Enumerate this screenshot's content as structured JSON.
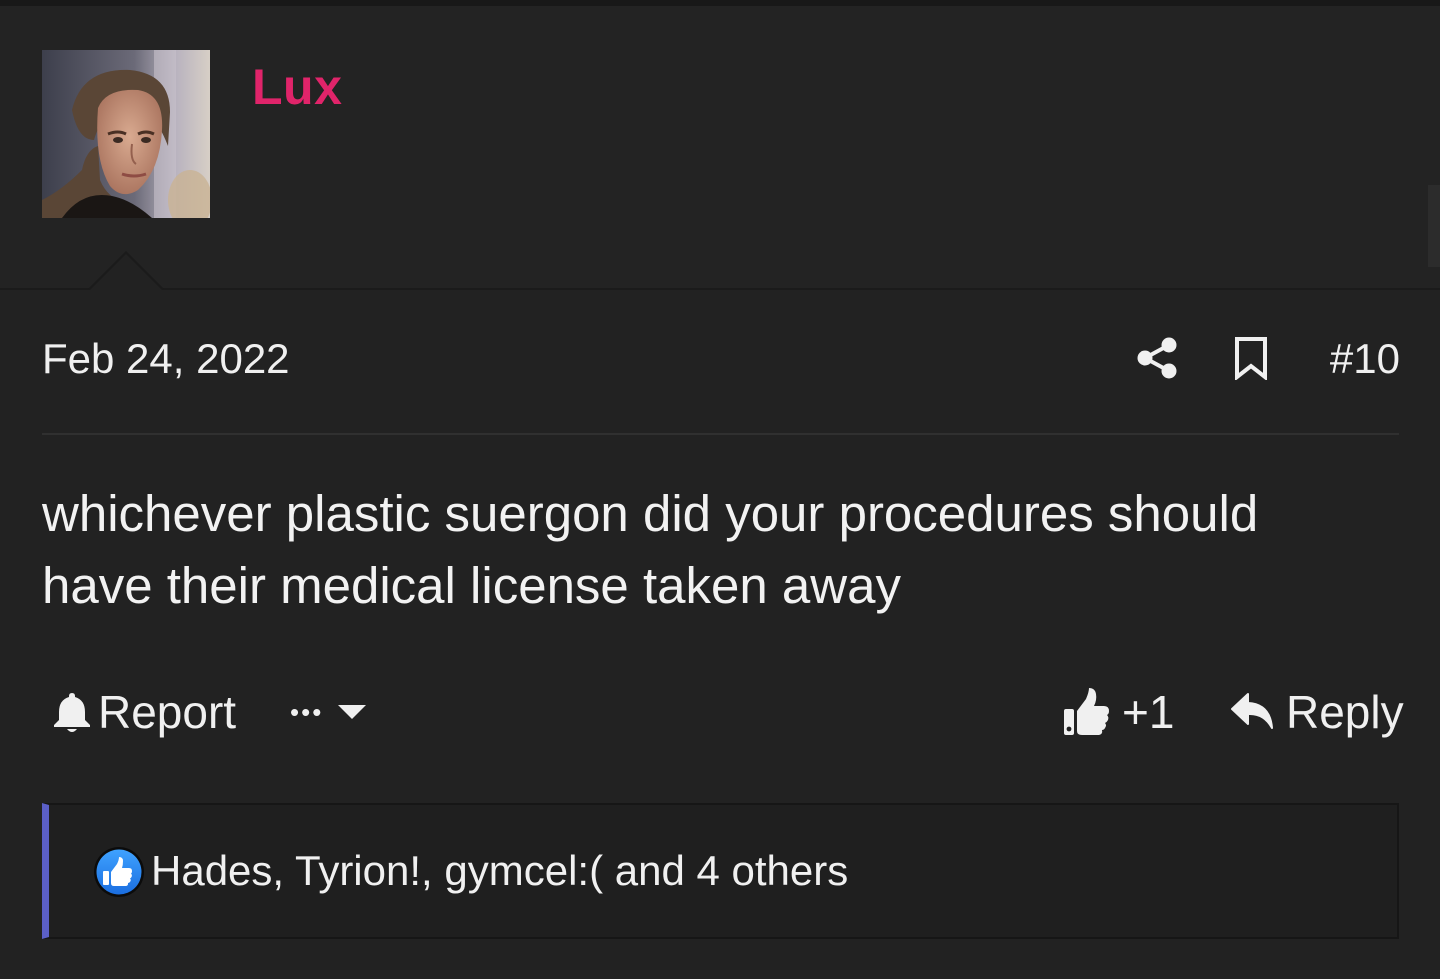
{
  "user": {
    "name": "Lux",
    "name_color": "#e0246a"
  },
  "post": {
    "date": "Feb 24, 2022",
    "number": "#10",
    "body": "whichever plastic suergon did your procedures should have their medical license taken away"
  },
  "actions": {
    "report_label": "Report",
    "more_glyph": "•••",
    "like_count": "+1",
    "reply_label": "Reply"
  },
  "reactions": {
    "text": "Hades, Tyrion!, gymcel:( and 4 others",
    "accent_color": "#5b5fc7",
    "icon": "thumbs-up-icon"
  },
  "icons": {
    "share": "share-icon",
    "bookmark": "bookmark-icon",
    "report": "bell-icon",
    "more": "ellipsis-icon",
    "dropdown": "caret-down-icon",
    "like": "thumbs-up-icon",
    "reply": "reply-arrow-icon"
  }
}
